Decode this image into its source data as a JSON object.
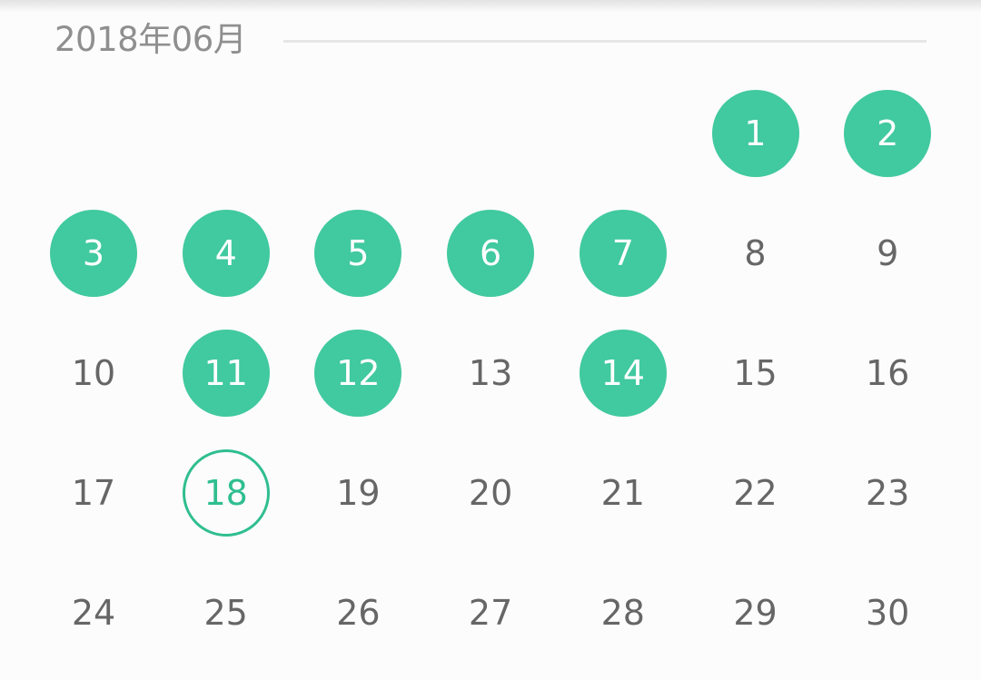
{
  "calendar": {
    "month_title": "2018年06月",
    "colors": {
      "marked_fill": "#41c99f",
      "today_ring": "#2fbe90",
      "day_text": "#666666",
      "header_text": "#8f8f8f"
    },
    "weeks": [
      [
        {
          "day": "",
          "state": "empty"
        },
        {
          "day": "",
          "state": "empty"
        },
        {
          "day": "",
          "state": "empty"
        },
        {
          "day": "",
          "state": "empty"
        },
        {
          "day": "",
          "state": "empty"
        },
        {
          "day": "1",
          "state": "marked"
        },
        {
          "day": "2",
          "state": "marked"
        }
      ],
      [
        {
          "day": "3",
          "state": "marked"
        },
        {
          "day": "4",
          "state": "marked"
        },
        {
          "day": "5",
          "state": "marked"
        },
        {
          "day": "6",
          "state": "marked"
        },
        {
          "day": "7",
          "state": "marked"
        },
        {
          "day": "8",
          "state": "normal"
        },
        {
          "day": "9",
          "state": "normal"
        }
      ],
      [
        {
          "day": "10",
          "state": "normal"
        },
        {
          "day": "11",
          "state": "marked"
        },
        {
          "day": "12",
          "state": "marked"
        },
        {
          "day": "13",
          "state": "normal"
        },
        {
          "day": "14",
          "state": "marked"
        },
        {
          "day": "15",
          "state": "normal"
        },
        {
          "day": "16",
          "state": "normal"
        }
      ],
      [
        {
          "day": "17",
          "state": "normal"
        },
        {
          "day": "18",
          "state": "today"
        },
        {
          "day": "19",
          "state": "normal"
        },
        {
          "day": "20",
          "state": "normal"
        },
        {
          "day": "21",
          "state": "normal"
        },
        {
          "day": "22",
          "state": "normal"
        },
        {
          "day": "23",
          "state": "normal"
        }
      ],
      [
        {
          "day": "24",
          "state": "normal"
        },
        {
          "day": "25",
          "state": "normal"
        },
        {
          "day": "26",
          "state": "normal"
        },
        {
          "day": "27",
          "state": "normal"
        },
        {
          "day": "28",
          "state": "normal"
        },
        {
          "day": "29",
          "state": "normal"
        },
        {
          "day": "30",
          "state": "normal"
        }
      ]
    ]
  }
}
